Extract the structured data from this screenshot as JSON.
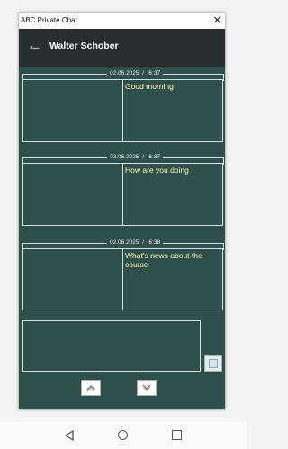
{
  "window": {
    "title": "ABC Private Chat",
    "close_glyph": "✕"
  },
  "appbar": {
    "back_icon": "arrow-left-icon",
    "back_glyph": "←",
    "contact_name": "Walter Schober"
  },
  "messages": [
    {
      "date": "02.06.2025",
      "separator": "/",
      "time": "6:37",
      "text": "Good morning"
    },
    {
      "date": "02.06.2025",
      "separator": "/",
      "time": "6:37",
      "text": "How are you doing"
    },
    {
      "date": "02.06.2025",
      "separator": "/",
      "time": "6:38",
      "text": "What's news about the course"
    }
  ],
  "composer": {
    "value": "",
    "send_icon": "send-icon"
  },
  "navigation": {
    "up_icon": "chevron-up-icon",
    "down_icon": "chevron-down-icon"
  },
  "system_nav": {
    "back_icon": "back-triangle-icon",
    "home_icon": "home-circle-icon",
    "recents_icon": "recents-square-icon"
  },
  "colors": {
    "app_background": "#2f4f4a",
    "appbar_background": "#2a2d2d",
    "message_text": "#fff8b8",
    "border": "#cfe3de"
  }
}
